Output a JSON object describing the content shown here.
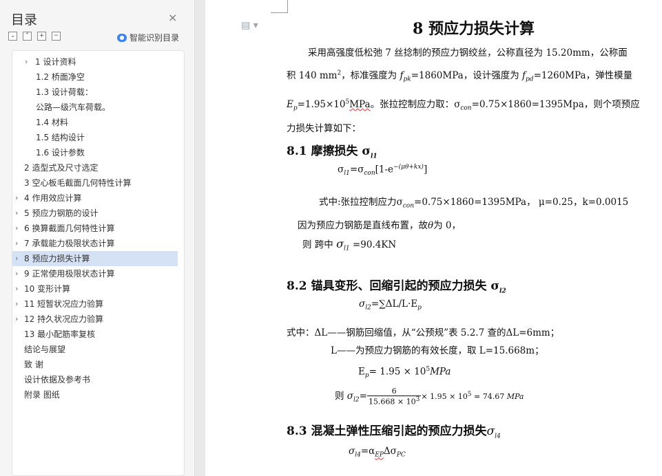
{
  "sidebar": {
    "title": "目录",
    "close": "×",
    "tools": [
      "⌄",
      "⌃",
      "+",
      "−"
    ],
    "smart_label": "智能识别目录",
    "items": [
      {
        "label": "1 设计资料"
      },
      {
        "label": "1.2 桥面净空"
      },
      {
        "label": "1.3 设计荷载："
      },
      {
        "label": "公路—级汽车荷载。"
      },
      {
        "label": "1.4 材料"
      },
      {
        "label": "1.5 结构设计"
      },
      {
        "label": "1.6  设计参数"
      },
      {
        "label": "2 造型式及尺寸选定"
      },
      {
        "label": "3 空心板毛截面几何特性计算"
      },
      {
        "label": "4 作用效应计算"
      },
      {
        "label": "5 预应力钢筋的设计"
      },
      {
        "label": "6 换算截面几何特性计算"
      },
      {
        "label": "7 承载能力极限状态计算"
      },
      {
        "label": "8 预应力损失计算"
      },
      {
        "label": "9 正常使用极限状态计算"
      },
      {
        "label": "10 变形计算"
      },
      {
        "label": "11 短暂状况应力验算"
      },
      {
        "label": "12 持久状况应力验算"
      },
      {
        "label": "13  最小配筋率复核"
      },
      {
        "label": "结论与展望"
      },
      {
        "label": "致  谢"
      },
      {
        "label": "设计依据及参考书"
      },
      {
        "label": "附录    图纸"
      }
    ]
  },
  "doc": {
    "title": "8 预应力损失计算",
    "p1": "采用高强度低松弛 7 丝捻制的预应力钢绞丝，公称直径为 15.20mm，公称面",
    "p2a": "积 140  mm",
    "p2sup": "2",
    "p2b": "，标准强度为",
    "fpk": "f",
    "fpk_sub": "pk",
    "p2c": "=1860MPa，设计强度为",
    "fpd": "f",
    "fpd_sub": "pd",
    "p2d": "=1260MPa，弹性模量",
    "ep": "E",
    "ep_sub": "p",
    "p3a": "=1.95×10",
    "p3sup": "5",
    "p3mpa": "MPa",
    "p3b": "。张拉控制应力取：σ",
    "p3sub": "con",
    "p3c": "=0.75×1860=1395Mpa，则个项预应",
    "p4": "力损失计算如下：",
    "s81": "8.1 摩擦损失 σ",
    "s81_sub": "l1",
    "f81a": "σ",
    "f81a_sub": "l1",
    "f81b": "=σ",
    "f81b_sub": "con",
    "f81c": "[1-e",
    "f81sup": "−(μθ+kx)",
    "f81d": "]",
    "w81a": "式中:张拉控制应力σ",
    "w81sub": "con",
    "w81b": "=0.75×1860=1395MPa， μ=0.25，k=0.0015",
    "l81a": "因为预应力钢筋是直线布置，故",
    "l81theta": "θ",
    "l81b": "为 0，",
    "m81a": "则 跨中",
    "m81sig": "σ",
    "m81sub": "l1",
    "m81b": "=90.4KN",
    "s82": "8.2 锚具变形、回缩引起的预应力损失 σ",
    "s82_sub": "l2",
    "f82a": "σ",
    "f82a_sub": "l2",
    "f82b": "=∑ΔL/L·E",
    "f82b_sub": "p",
    "w82": "式中：ΔL——钢筋回缩值，从“公预规”表 5.2.7 查的ΔL=6mm；",
    "w82b": "L——为预应力钢筋的有效长度，取 L=15.668m；",
    "e82a": "E",
    "e82sub": "p",
    "e82b": "= 1.95 × 10",
    "e82sup": "5",
    "e82c": "MPa",
    "r82a": "则",
    "r82sig": "σ",
    "r82sub": "l2",
    "r82eq": "=",
    "r82num": "6",
    "r82den": "15.668 × 10",
    "r82densup": "3",
    "r82b": "× 1.95 × 10",
    "r82bsup": "5",
    "r82c": "= 74.67",
    "r82d": "MPa",
    "s83": "8.3 混凝土弹性压缩引起的预应力损失",
    "s83sig": "σ",
    "s83_sub": "l4",
    "f83a": "σ",
    "f83a_sub": "l4",
    "f83b": "=α",
    "f83b_sub": "EP",
    "f83c": "Δσ",
    "f83c_sub": "PC"
  }
}
